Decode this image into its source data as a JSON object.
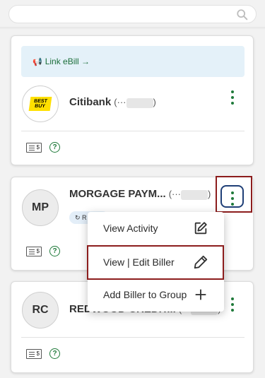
{
  "search": {
    "placeholder": ""
  },
  "billers": [
    {
      "ebill_link": "Link eBill →",
      "logo_text": [
        "BEST",
        "BUY"
      ],
      "name": "Citibank",
      "account_prefix": "(···",
      "account_suffix": ")"
    },
    {
      "initials": "MP",
      "name": "MORGAGE PAYM...",
      "account_prefix": "(···",
      "account_suffix": ")",
      "pill_label": "R"
    },
    {
      "initials": "RC",
      "name": "REDWOOD CREDIT...",
      "account_prefix": "(···",
      "account_suffix": ")"
    }
  ],
  "menu": {
    "items": [
      {
        "label": "View Activity",
        "icon": "edit-square-icon"
      },
      {
        "label": "View | Edit Biller",
        "icon": "pencil-icon"
      },
      {
        "label": "Add Biller to Group",
        "icon": "plus-icon"
      }
    ]
  },
  "icons": {
    "bill": "$",
    "help": "?"
  },
  "colors": {
    "accent": "#1f7a3a",
    "highlight": "#8c1d1d",
    "focus": "#1f3f77",
    "banner": "#e4f1f9"
  }
}
